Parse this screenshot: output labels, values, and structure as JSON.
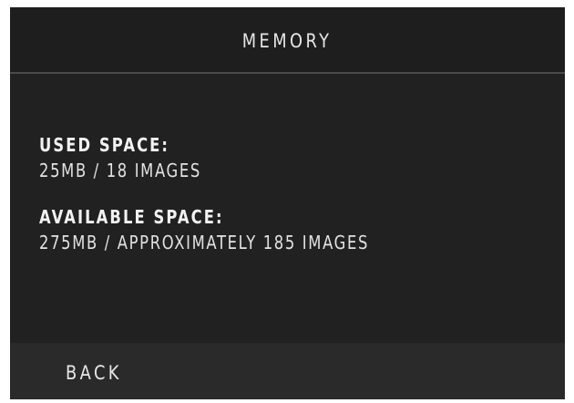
{
  "header": {
    "title": "MEMORY"
  },
  "memory": {
    "used": {
      "label": "USED SPACE:",
      "value": "25MB / 18 IMAGES"
    },
    "available": {
      "label": "AVAILABLE SPACE:",
      "value": "275MB / APPROXIMATELY 185 IMAGES"
    }
  },
  "footer": {
    "back_label": "BACK"
  },
  "colors": {
    "background": "#212121",
    "header_background": "#1e1e1e",
    "footer_background": "#2a2a2a",
    "divider": "#4a4a4a",
    "text": "#e9e9e9"
  }
}
